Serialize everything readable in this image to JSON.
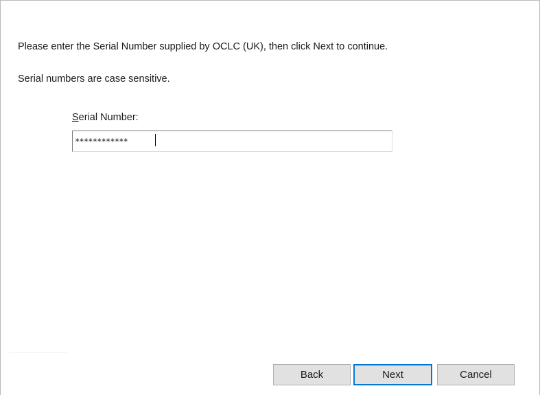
{
  "dialog": {
    "instruction_text": "Please enter the Serial Number supplied by OCLC (UK), then click Next to continue.",
    "case_note_text": "Serial numbers are case sensitive.",
    "serial_field": {
      "label_mnemonic": "S",
      "label_rest": "erial Number:",
      "value": "************"
    }
  },
  "buttons": {
    "back_label": "Back",
    "next_label": "Next",
    "cancel_label": "Cancel"
  },
  "colors": {
    "focus_accent": "#0078d7",
    "button_face": "#e1e1e1"
  }
}
